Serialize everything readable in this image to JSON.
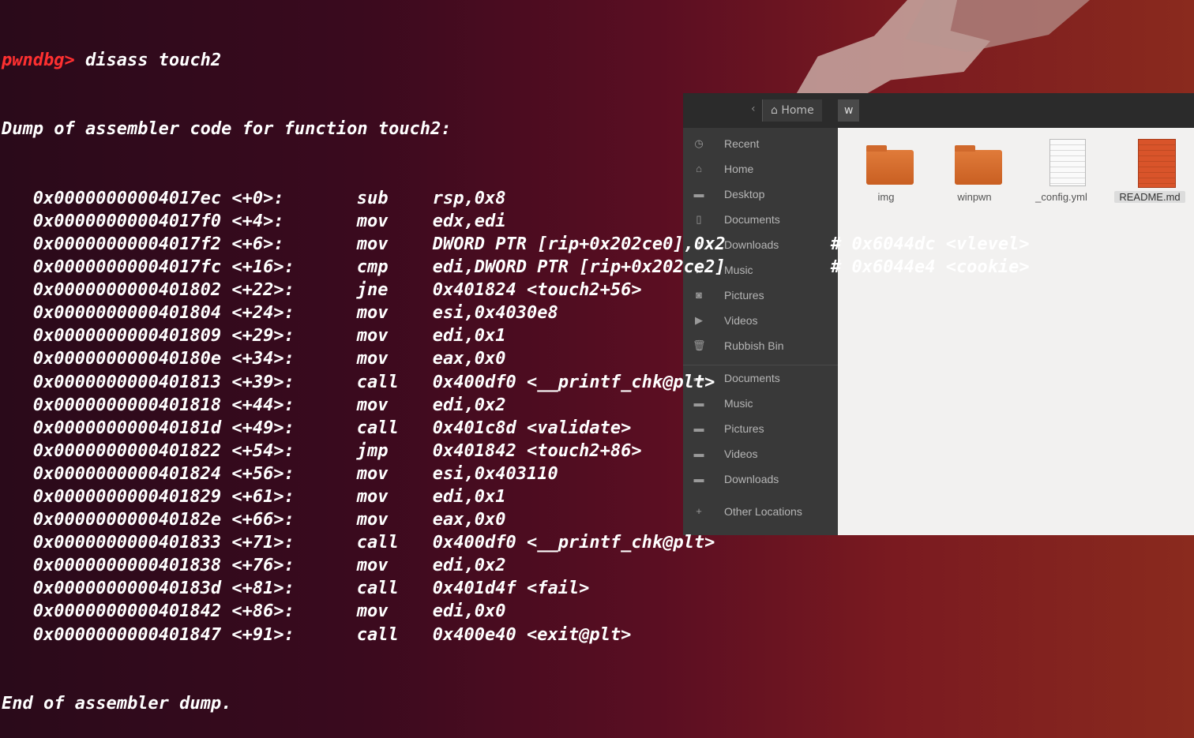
{
  "terminal": {
    "prompt": "pwndbg>",
    "command": " disass touch2",
    "header": "Dump of assembler code for function touch2:",
    "instructions": [
      {
        "addr": "0x00000000004017ec <+0>:",
        "mnemonic": "sub",
        "operands": "rsp,0x8",
        "comment": ""
      },
      {
        "addr": "0x00000000004017f0 <+4>:",
        "mnemonic": "mov",
        "operands": "edx,edi",
        "comment": ""
      },
      {
        "addr": "0x00000000004017f2 <+6>:",
        "mnemonic": "mov",
        "operands": "DWORD PTR [rip+0x202ce0],0x2",
        "comment": "# 0x6044dc <vlevel>"
      },
      {
        "addr": "0x00000000004017fc <+16>:",
        "mnemonic": "cmp",
        "operands": "edi,DWORD PTR [rip+0x202ce2]",
        "comment": "# 0x6044e4 <cookie>"
      },
      {
        "addr": "0x0000000000401802 <+22>:",
        "mnemonic": "jne",
        "operands": "0x401824 <touch2+56>",
        "comment": ""
      },
      {
        "addr": "0x0000000000401804 <+24>:",
        "mnemonic": "mov",
        "operands": "esi,0x4030e8",
        "comment": ""
      },
      {
        "addr": "0x0000000000401809 <+29>:",
        "mnemonic": "mov",
        "operands": "edi,0x1",
        "comment": ""
      },
      {
        "addr": "0x000000000040180e <+34>:",
        "mnemonic": "mov",
        "operands": "eax,0x0",
        "comment": ""
      },
      {
        "addr": "0x0000000000401813 <+39>:",
        "mnemonic": "call",
        "operands": "0x400df0 <__printf_chk@plt>",
        "comment": ""
      },
      {
        "addr": "0x0000000000401818 <+44>:",
        "mnemonic": "mov",
        "operands": "edi,0x2",
        "comment": ""
      },
      {
        "addr": "0x000000000040181d <+49>:",
        "mnemonic": "call",
        "operands": "0x401c8d <validate>",
        "comment": ""
      },
      {
        "addr": "0x0000000000401822 <+54>:",
        "mnemonic": "jmp",
        "operands": "0x401842 <touch2+86>",
        "comment": ""
      },
      {
        "addr": "0x0000000000401824 <+56>:",
        "mnemonic": "mov",
        "operands": "esi,0x403110",
        "comment": ""
      },
      {
        "addr": "0x0000000000401829 <+61>:",
        "mnemonic": "mov",
        "operands": "edi,0x1",
        "comment": ""
      },
      {
        "addr": "0x000000000040182e <+66>:",
        "mnemonic": "mov",
        "operands": "eax,0x0",
        "comment": ""
      },
      {
        "addr": "0x0000000000401833 <+71>:",
        "mnemonic": "call",
        "operands": "0x400df0 <__printf_chk@plt>",
        "comment": ""
      },
      {
        "addr": "0x0000000000401838 <+76>:",
        "mnemonic": "mov",
        "operands": "edi,0x2",
        "comment": ""
      },
      {
        "addr": "0x000000000040183d <+81>:",
        "mnemonic": "call",
        "operands": "0x401d4f <fail>",
        "comment": ""
      },
      {
        "addr": "0x0000000000401842 <+86>:",
        "mnemonic": "mov",
        "operands": "edi,0x0",
        "comment": ""
      },
      {
        "addr": "0x0000000000401847 <+91>:",
        "mnemonic": "call",
        "operands": "0x400e40 <exit@plt>",
        "comment": ""
      }
    ],
    "footer": "End of assembler dump."
  },
  "file_manager": {
    "breadcrumb_home": "Home",
    "breadcrumb_current": "w",
    "sidebar": [
      {
        "icon": "recent-icon",
        "glyph": "◷",
        "label": "Recent"
      },
      {
        "icon": "home-icon",
        "glyph": "⌂",
        "label": "Home"
      },
      {
        "icon": "folder-icon",
        "glyph": "▬",
        "label": "Desktop"
      },
      {
        "icon": "document-icon",
        "glyph": "▯",
        "label": "Documents"
      },
      {
        "icon": "download-icon",
        "glyph": "⤓",
        "label": "Downloads"
      },
      {
        "icon": "music-icon",
        "glyph": "♫",
        "label": "Music"
      },
      {
        "icon": "camera-icon",
        "glyph": "◙",
        "label": "Pictures"
      },
      {
        "icon": "video-icon",
        "glyph": "▶",
        "label": "Videos"
      },
      {
        "icon": "trash-icon",
        "glyph": "🗑",
        "label": "Rubbish Bin"
      },
      {
        "icon": "folder-icon",
        "glyph": "▬",
        "label": "Documents"
      },
      {
        "icon": "folder-icon",
        "glyph": "▬",
        "label": "Music"
      },
      {
        "icon": "folder-icon",
        "glyph": "▬",
        "label": "Pictures"
      },
      {
        "icon": "folder-icon",
        "glyph": "▬",
        "label": "Videos"
      },
      {
        "icon": "folder-icon",
        "glyph": "▬",
        "label": "Downloads"
      },
      {
        "icon": "plus-icon",
        "glyph": "+",
        "label": "Other Locations"
      }
    ],
    "files": [
      {
        "name": "img",
        "type": "folder"
      },
      {
        "name": "winpwn",
        "type": "folder"
      },
      {
        "name": "_config.yml",
        "type": "doc"
      },
      {
        "name": "README.md",
        "type": "doc-red"
      }
    ]
  },
  "colors": {
    "prompt": "#ff3030",
    "terminal_text": "#ffffff",
    "sidebar_bg": "#393939"
  }
}
